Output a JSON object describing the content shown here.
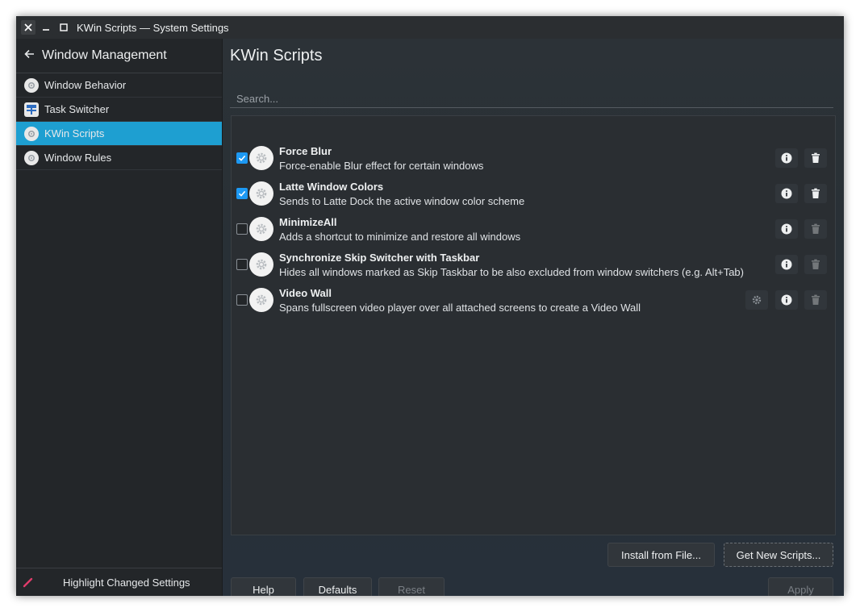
{
  "window": {
    "title": "KWin Scripts — System Settings",
    "controls": {
      "close": "✕",
      "minimize": "_",
      "maximize": "□"
    }
  },
  "sidebar": {
    "header": "Window Management",
    "items": [
      {
        "label": "Window Behavior",
        "icon": "window-behavior-icon",
        "active": false
      },
      {
        "label": "Task Switcher",
        "icon": "task-switcher-icon",
        "active": false
      },
      {
        "label": "KWin Scripts",
        "icon": "kwin-scripts-icon",
        "active": true
      },
      {
        "label": "Window Rules",
        "icon": "window-rules-icon",
        "active": false
      }
    ],
    "footer": "Highlight Changed Settings"
  },
  "main": {
    "title": "KWin Scripts",
    "search_placeholder": "Search...",
    "scripts": [
      {
        "name": "Force Blur",
        "description": "Force-enable Blur effect for certain windows",
        "enabled": true,
        "configurable": false,
        "removable": true
      },
      {
        "name": "Latte Window Colors",
        "description": "Sends to Latte Dock the active window color scheme",
        "enabled": true,
        "configurable": false,
        "removable": true
      },
      {
        "name": "MinimizeAll",
        "description": "Adds a shortcut to minimize and restore all windows",
        "enabled": false,
        "configurable": false,
        "removable": false
      },
      {
        "name": "Synchronize Skip Switcher with Taskbar",
        "description": "Hides all windows marked as Skip Taskbar to be also excluded from window switchers (e.g. Alt+Tab)",
        "enabled": false,
        "configurable": false,
        "removable": false
      },
      {
        "name": "Video Wall",
        "description": "Spans fullscreen video player over all attached screens to create a Video Wall",
        "enabled": false,
        "configurable": true,
        "removable": false
      }
    ],
    "install_button": "Install from File...",
    "get_new_button": "Get New Scripts...",
    "help_button": "Help",
    "defaults_button": "Defaults",
    "reset_button": "Reset",
    "apply_button": "Apply"
  },
  "colors": {
    "accent": "#1e9fd1",
    "checkbox": "#1d99f3",
    "background": "#232629"
  }
}
